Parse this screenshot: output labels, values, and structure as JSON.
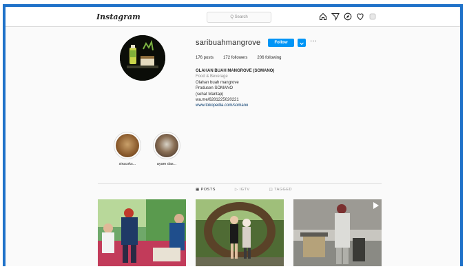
{
  "header": {
    "logo": "Instagram",
    "search_placeholder": "Q Search",
    "nav_icons": [
      "home-icon",
      "direct-icon",
      "explore-icon",
      "activity-icon",
      "profile-icon"
    ]
  },
  "profile": {
    "username": "saribuahmangrove",
    "follow_label": "Follow",
    "more_label": "···",
    "stats": {
      "posts": "176 posts",
      "followers": "172 followers",
      "following": "206 following"
    },
    "bio": {
      "name": "OLAHAN BUAH MANGROVE (SOMANO)",
      "category": "Food & Beverage",
      "lines": [
        "Olahan buah mangrove",
        "Produsen SOMANO",
        "(sehat Mantap)",
        "wa.me/6281225020221"
      ],
      "link": "www.tokopedia.com/somano"
    }
  },
  "highlights": [
    {
      "label": "sirucoks..."
    },
    {
      "label": "ayam das..."
    }
  ],
  "tabs": [
    {
      "label": "▦ POSTS"
    },
    {
      "label": "▷ IGTV"
    },
    {
      "label": "◫ TAGGED"
    }
  ],
  "colors": {
    "frame": "#1f72c9",
    "follow": "#0095f6",
    "background": "#fafafa"
  }
}
